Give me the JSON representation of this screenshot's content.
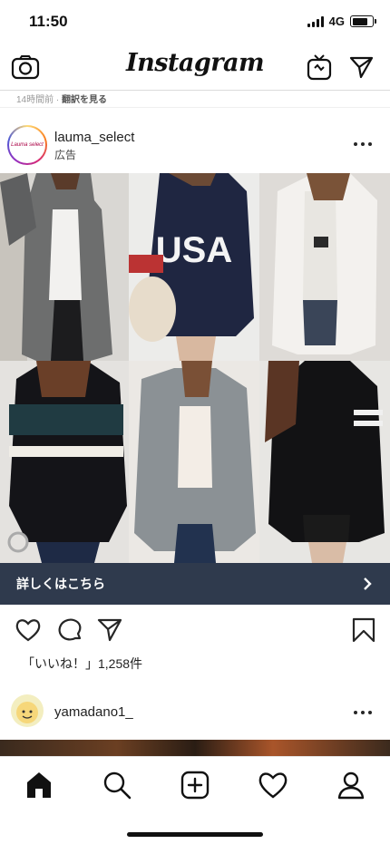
{
  "status_bar": {
    "time": "11:50",
    "network": "4G"
  },
  "header": {
    "logo": "Instagram"
  },
  "previous_post": {
    "time_ago": "14時間前",
    "separator": " · ",
    "see_translation": "翻訳を見る"
  },
  "post": {
    "username": "lauma_select",
    "sponsored": "広告",
    "avatar_text": "Lauma select",
    "cta_label": "詳しくはこちら",
    "likes": "「いいね！」1,258件"
  },
  "next_post": {
    "username": "yamadano1_"
  },
  "colors": {
    "cta_bar": "#2f3a4d",
    "text": "#262626"
  },
  "icons": [
    "camera-icon",
    "igtv-icon",
    "direct-icon",
    "more-icon",
    "heart-icon",
    "comment-icon",
    "share-icon",
    "bookmark-icon",
    "home-icon",
    "search-icon",
    "add-icon",
    "activity-icon",
    "profile-icon"
  ]
}
